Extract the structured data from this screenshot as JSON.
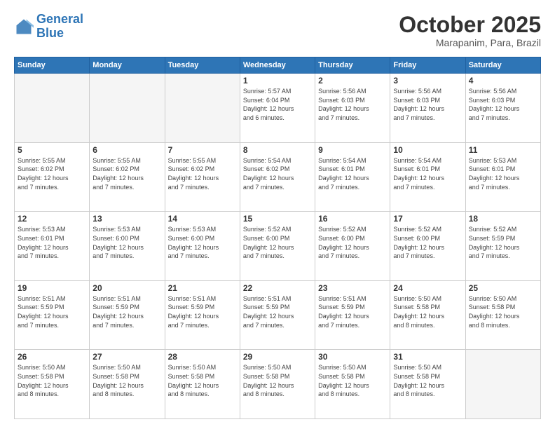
{
  "logo": {
    "line1": "General",
    "line2": "Blue"
  },
  "title": "October 2025",
  "subtitle": "Marapanim, Para, Brazil",
  "headers": [
    "Sunday",
    "Monday",
    "Tuesday",
    "Wednesday",
    "Thursday",
    "Friday",
    "Saturday"
  ],
  "weeks": [
    [
      {
        "day": "",
        "info": ""
      },
      {
        "day": "",
        "info": ""
      },
      {
        "day": "",
        "info": ""
      },
      {
        "day": "1",
        "info": "Sunrise: 5:57 AM\nSunset: 6:04 PM\nDaylight: 12 hours\nand 6 minutes."
      },
      {
        "day": "2",
        "info": "Sunrise: 5:56 AM\nSunset: 6:03 PM\nDaylight: 12 hours\nand 7 minutes."
      },
      {
        "day": "3",
        "info": "Sunrise: 5:56 AM\nSunset: 6:03 PM\nDaylight: 12 hours\nand 7 minutes."
      },
      {
        "day": "4",
        "info": "Sunrise: 5:56 AM\nSunset: 6:03 PM\nDaylight: 12 hours\nand 7 minutes."
      }
    ],
    [
      {
        "day": "5",
        "info": "Sunrise: 5:55 AM\nSunset: 6:02 PM\nDaylight: 12 hours\nand 7 minutes."
      },
      {
        "day": "6",
        "info": "Sunrise: 5:55 AM\nSunset: 6:02 PM\nDaylight: 12 hours\nand 7 minutes."
      },
      {
        "day": "7",
        "info": "Sunrise: 5:55 AM\nSunset: 6:02 PM\nDaylight: 12 hours\nand 7 minutes."
      },
      {
        "day": "8",
        "info": "Sunrise: 5:54 AM\nSunset: 6:02 PM\nDaylight: 12 hours\nand 7 minutes."
      },
      {
        "day": "9",
        "info": "Sunrise: 5:54 AM\nSunset: 6:01 PM\nDaylight: 12 hours\nand 7 minutes."
      },
      {
        "day": "10",
        "info": "Sunrise: 5:54 AM\nSunset: 6:01 PM\nDaylight: 12 hours\nand 7 minutes."
      },
      {
        "day": "11",
        "info": "Sunrise: 5:53 AM\nSunset: 6:01 PM\nDaylight: 12 hours\nand 7 minutes."
      }
    ],
    [
      {
        "day": "12",
        "info": "Sunrise: 5:53 AM\nSunset: 6:01 PM\nDaylight: 12 hours\nand 7 minutes."
      },
      {
        "day": "13",
        "info": "Sunrise: 5:53 AM\nSunset: 6:00 PM\nDaylight: 12 hours\nand 7 minutes."
      },
      {
        "day": "14",
        "info": "Sunrise: 5:53 AM\nSunset: 6:00 PM\nDaylight: 12 hours\nand 7 minutes."
      },
      {
        "day": "15",
        "info": "Sunrise: 5:52 AM\nSunset: 6:00 PM\nDaylight: 12 hours\nand 7 minutes."
      },
      {
        "day": "16",
        "info": "Sunrise: 5:52 AM\nSunset: 6:00 PM\nDaylight: 12 hours\nand 7 minutes."
      },
      {
        "day": "17",
        "info": "Sunrise: 5:52 AM\nSunset: 6:00 PM\nDaylight: 12 hours\nand 7 minutes."
      },
      {
        "day": "18",
        "info": "Sunrise: 5:52 AM\nSunset: 5:59 PM\nDaylight: 12 hours\nand 7 minutes."
      }
    ],
    [
      {
        "day": "19",
        "info": "Sunrise: 5:51 AM\nSunset: 5:59 PM\nDaylight: 12 hours\nand 7 minutes."
      },
      {
        "day": "20",
        "info": "Sunrise: 5:51 AM\nSunset: 5:59 PM\nDaylight: 12 hours\nand 7 minutes."
      },
      {
        "day": "21",
        "info": "Sunrise: 5:51 AM\nSunset: 5:59 PM\nDaylight: 12 hours\nand 7 minutes."
      },
      {
        "day": "22",
        "info": "Sunrise: 5:51 AM\nSunset: 5:59 PM\nDaylight: 12 hours\nand 7 minutes."
      },
      {
        "day": "23",
        "info": "Sunrise: 5:51 AM\nSunset: 5:59 PM\nDaylight: 12 hours\nand 7 minutes."
      },
      {
        "day": "24",
        "info": "Sunrise: 5:50 AM\nSunset: 5:58 PM\nDaylight: 12 hours\nand 8 minutes."
      },
      {
        "day": "25",
        "info": "Sunrise: 5:50 AM\nSunset: 5:58 PM\nDaylight: 12 hours\nand 8 minutes."
      }
    ],
    [
      {
        "day": "26",
        "info": "Sunrise: 5:50 AM\nSunset: 5:58 PM\nDaylight: 12 hours\nand 8 minutes."
      },
      {
        "day": "27",
        "info": "Sunrise: 5:50 AM\nSunset: 5:58 PM\nDaylight: 12 hours\nand 8 minutes."
      },
      {
        "day": "28",
        "info": "Sunrise: 5:50 AM\nSunset: 5:58 PM\nDaylight: 12 hours\nand 8 minutes."
      },
      {
        "day": "29",
        "info": "Sunrise: 5:50 AM\nSunset: 5:58 PM\nDaylight: 12 hours\nand 8 minutes."
      },
      {
        "day": "30",
        "info": "Sunrise: 5:50 AM\nSunset: 5:58 PM\nDaylight: 12 hours\nand 8 minutes."
      },
      {
        "day": "31",
        "info": "Sunrise: 5:50 AM\nSunset: 5:58 PM\nDaylight: 12 hours\nand 8 minutes."
      },
      {
        "day": "",
        "info": ""
      }
    ]
  ]
}
